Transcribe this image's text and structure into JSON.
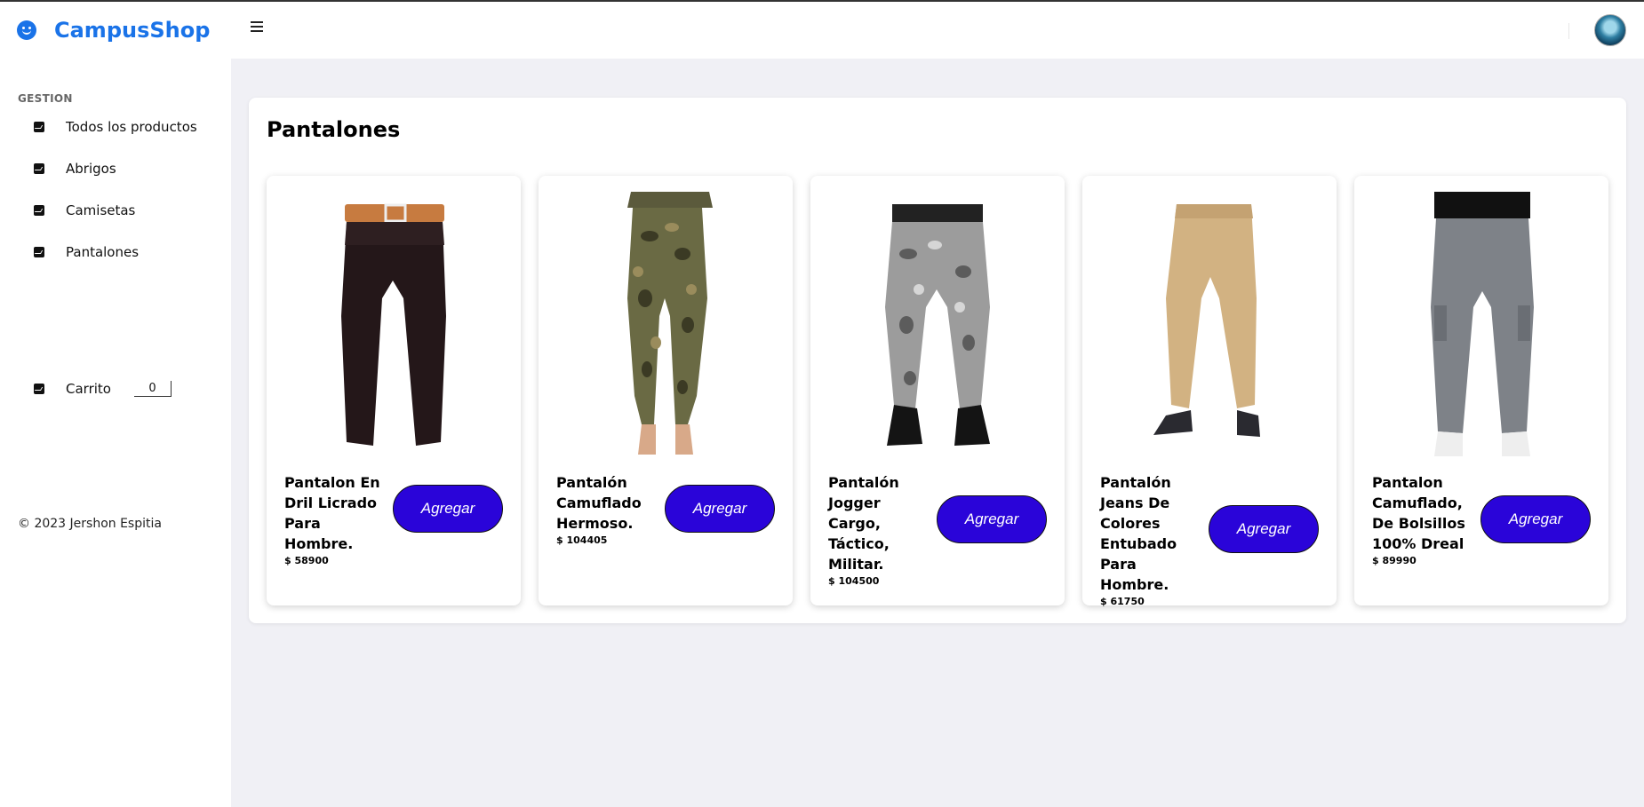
{
  "header": {
    "brand_name": "CampusShop"
  },
  "sidebar": {
    "heading": "GESTION",
    "items": [
      {
        "label": "Todos los productos"
      },
      {
        "label": "Abrigos"
      },
      {
        "label": "Camisetas"
      },
      {
        "label": "Pantalones"
      }
    ],
    "cart": {
      "label": "Carrito",
      "count": "0"
    },
    "copyright": "© 2023 Jershon Espitia"
  },
  "main": {
    "title": "Pantalones",
    "products": [
      {
        "name": "Pantalon En Dril Licrado Para Hombre.",
        "price": "$ 58900",
        "button": "Agregar"
      },
      {
        "name": "Pantalón Camuflado Hermoso.",
        "price": "$ 104405",
        "button": "Agregar"
      },
      {
        "name": "Pantalón Jogger Cargo, Táctico, Militar.",
        "price": "$ 104500",
        "button": "Agregar"
      },
      {
        "name": "Pantalón Jeans De Colores Entubado Para Hombre.",
        "price": "$ 61750",
        "button": "Agregar"
      },
      {
        "name": "Pantalon Camuflado, De Bolsillos 100% Dreal",
        "price": "$ 89990",
        "button": "Agregar"
      }
    ]
  },
  "colors": {
    "brand": "#1a73e8",
    "button": "#2a04d9",
    "background": "#f0f0f5"
  }
}
